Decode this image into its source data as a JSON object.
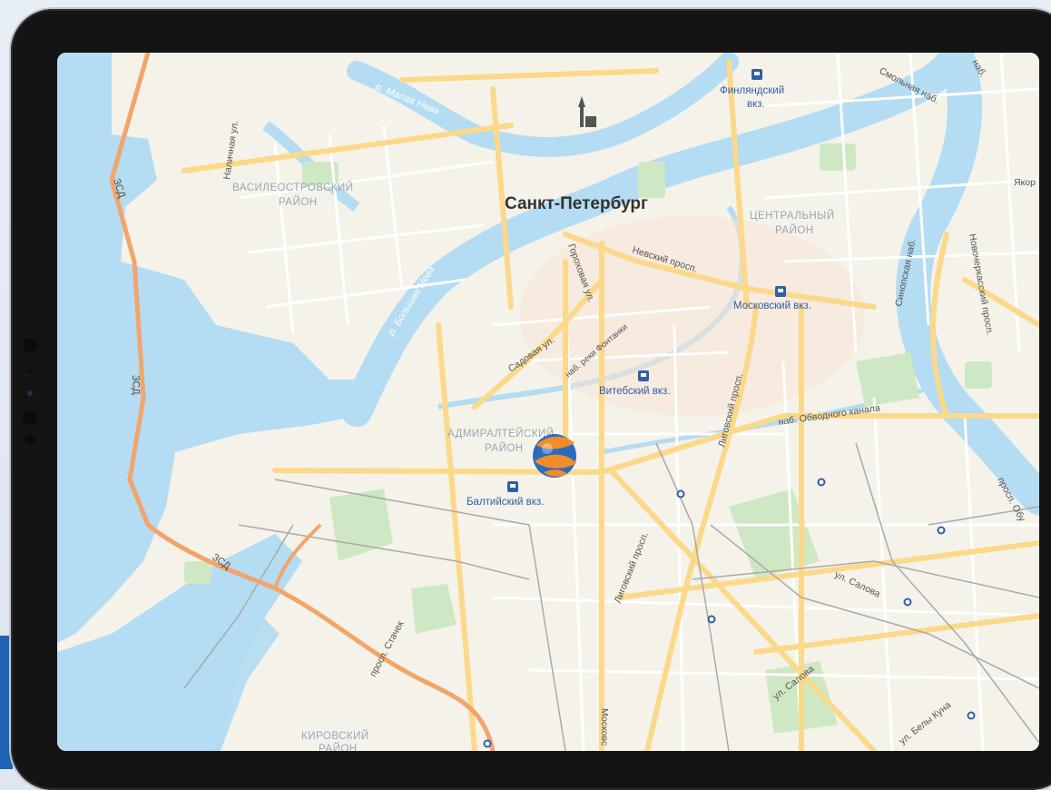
{
  "map": {
    "city": "Санкт-Петербург",
    "districts": [
      {
        "id": "vasileostrovsky",
        "line1": "ВАСИЛЕОСТРОВСКИЙ",
        "line2": "РАЙОН"
      },
      {
        "id": "central",
        "line1": "ЦЕНТРАЛЬНЫЙ",
        "line2": "РАЙОН"
      },
      {
        "id": "admiralteysky",
        "line1": "АДМИРАЛТЕЙСКИЙ",
        "line2": "РАЙОН"
      },
      {
        "id": "kirovsky",
        "line1": "КИРОВСКИЙ",
        "line2": "РАЙОН"
      }
    ],
    "rivers": {
      "malaya_neva": "р. Малая Нева",
      "bolshaya_neva": "р. Большая Нева"
    },
    "stations": {
      "finlyandsky_1": "Финляндский",
      "finlyandsky_2": "вкз.",
      "moskovsky": "Московский вкз.",
      "vitebsky": "Витебский вкз.",
      "baltiysky": "Балтийский вкз."
    },
    "streets": {
      "nalichnaya": "Наличная ул.",
      "gorokhovaya": "Гороховая ул.",
      "nevsky": "Невский просп.",
      "sadovaya": "Садовая ул.",
      "fontanka": "наб. реки Фонтанки",
      "ligovsky_1": "Лиговский просп.",
      "ligovsky_2": "Лиговский просп.",
      "obvodny": "наб. Обводного канала",
      "sinopskaya": "Синопская наб.",
      "novocherkassky": "Новочеркасский просп.",
      "smolnaya": "Смольная наб.",
      "nab_top": "наб.",
      "yakor": "Якор",
      "salova_1": "ул. Салова",
      "salova_2": "ул. Салова",
      "bely_kuna": "ул. Белы Куна",
      "stachek": "просп. Стачек",
      "moskovsky_pr": "Московс",
      "obu": "просп. Обу"
    },
    "highway": {
      "top": "ЗСД",
      "mid": "ЗСД",
      "bottom": "ЗСД"
    }
  },
  "colors": {
    "water": "#b4dcf2",
    "land": "#f5f2ea",
    "park": "#cfe8c4",
    "major_road": "#fbd98a",
    "minor_road": "#ffffff",
    "highway": "#f2a56a",
    "rail": "#a9a9a9",
    "station_blue": "#2f5fa6"
  }
}
